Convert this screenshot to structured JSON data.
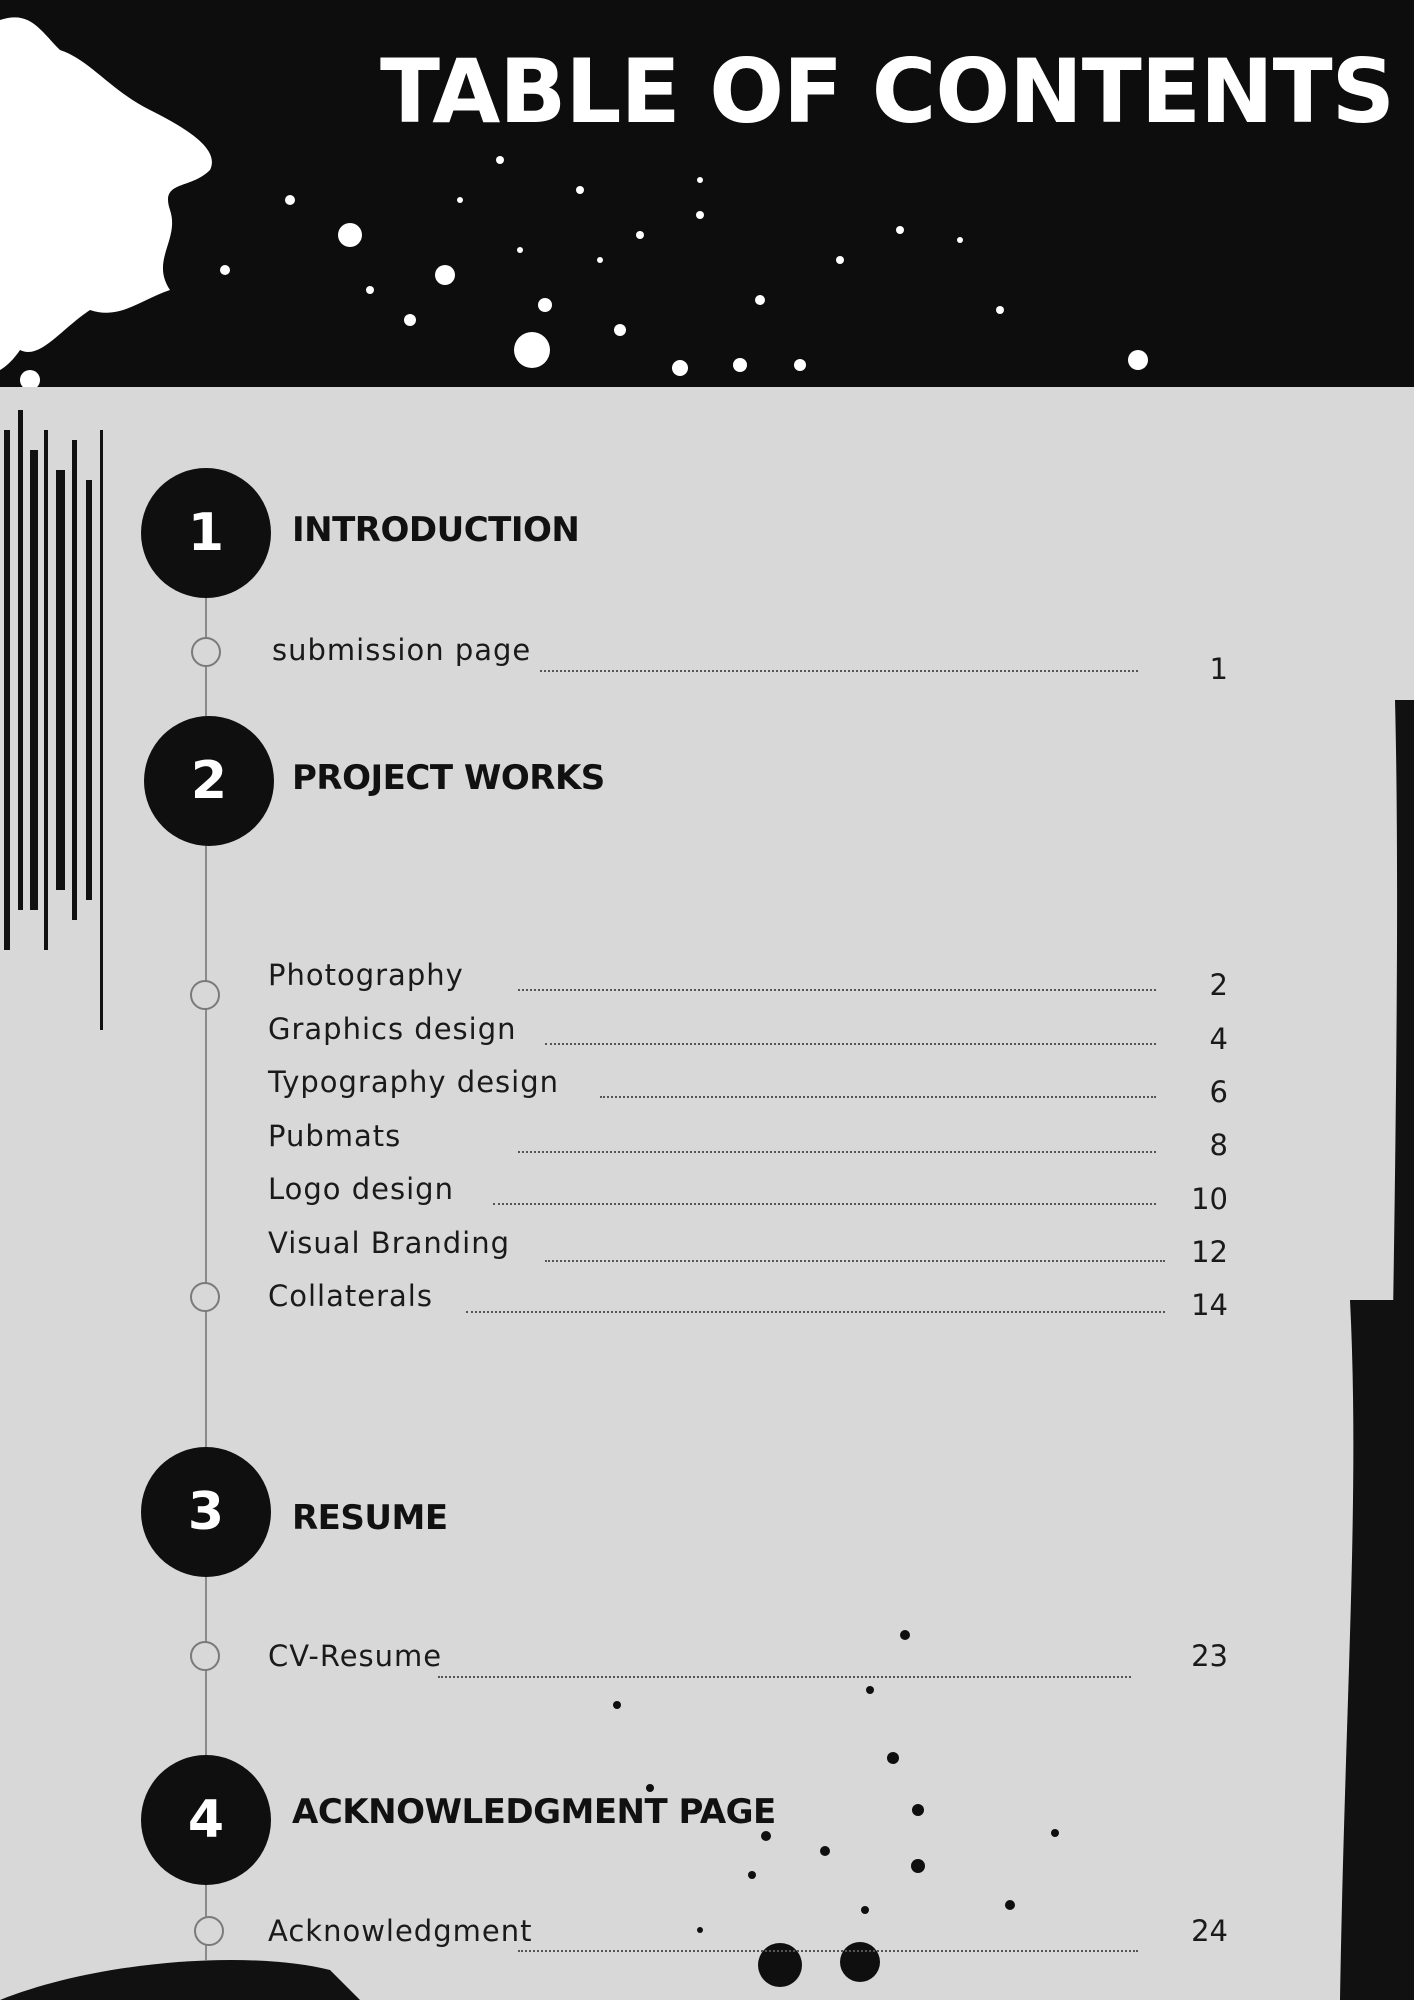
{
  "header": {
    "title": "TABLE OF CONTENTS"
  },
  "sections": [
    {
      "number": "1",
      "title": "INTRODUCTION",
      "entries": [
        {
          "label": "submission page",
          "page": "1"
        }
      ]
    },
    {
      "number": "2",
      "title": "PROJECT WORKS",
      "entries": [
        {
          "label": "Photography",
          "page": "2"
        },
        {
          "label": "Graphics design",
          "page": "4"
        },
        {
          "label": "Typography design",
          "page": "6"
        },
        {
          "label": "Pubmats",
          "page": "8"
        },
        {
          "label": "Logo design",
          "page": "10"
        },
        {
          "label": "Visual Branding",
          "page": "12"
        },
        {
          "label": "Collaterals",
          "page": "14"
        }
      ]
    },
    {
      "number": "3",
      "title": "RESUME",
      "entries": [
        {
          "label": "CV-Resume",
          "page": "23"
        }
      ]
    },
    {
      "number": "4",
      "title": "ACKNOWLEDGMENT PAGE",
      "entries": [
        {
          "label": "Acknowledgment",
          "page": "24"
        }
      ]
    }
  ],
  "colors": {
    "header_bg": "#0d0d0d",
    "page_bg": "#d8d8d8",
    "ink": "#111111"
  }
}
